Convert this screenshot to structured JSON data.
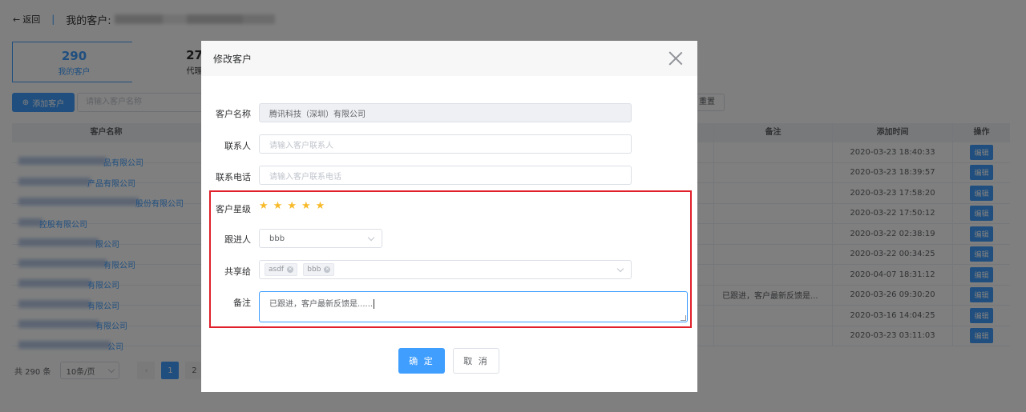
{
  "header": {
    "back_label": "返回",
    "title": "我的客户:"
  },
  "stats": [
    {
      "count": "290",
      "label": "我的客户"
    },
    {
      "count": "27",
      "label": "代理"
    }
  ],
  "toolbar": {
    "add_label": "添加客户",
    "search_placeholder": "请输入客户名称",
    "reset_label": "重置"
  },
  "table": {
    "headers": {
      "name": "客户名称",
      "note": "备注",
      "time": "添加时间",
      "op": "操作"
    },
    "rows": [
      {
        "name_tail": "品有限公司",
        "note": "",
        "time": "2020-03-23 18:40:33",
        "op": "编辑"
      },
      {
        "name_tail": "产品有限公司",
        "note": "",
        "time": "2020-03-23 18:39:57",
        "op": "编辑"
      },
      {
        "name_tail": "股份有限公司",
        "note": "",
        "time": "2020-03-23 17:58:20",
        "op": "编辑"
      },
      {
        "name_tail": "控股有限公司",
        "note": "",
        "time": "2020-03-22 17:50:12",
        "op": "编辑"
      },
      {
        "name_tail": "限公司",
        "note": "",
        "time": "2020-03-22 02:38:19",
        "op": "编辑"
      },
      {
        "name_tail": "有限公司",
        "note": "",
        "time": "2020-03-22 00:34:25",
        "op": "编辑"
      },
      {
        "name_tail": "有限公司",
        "note": "",
        "time": "2020-04-07 18:31:12",
        "op": "编辑"
      },
      {
        "name_tail": "有限公司",
        "note": "已跟进，客户最新反馈是...",
        "time": "2020-03-26 09:30:20",
        "op": "编辑"
      },
      {
        "name_tail": "有限公司",
        "note": "",
        "time": "2020-03-16 14:04:25",
        "op": "编辑"
      },
      {
        "name_tail": "公司",
        "note": "",
        "time": "2020-03-23 03:11:03",
        "op": "编辑"
      }
    ]
  },
  "pagination": {
    "total": "共 290 条",
    "page_size": "10条/页",
    "pages": [
      "1",
      "2"
    ]
  },
  "dialog": {
    "title": "修改客户",
    "fields": {
      "customer_name": {
        "label": "客户名称",
        "value": "腾讯科技（深圳）有限公司"
      },
      "contact": {
        "label": "联系人",
        "placeholder": "请输入客户联系人"
      },
      "phone": {
        "label": "联系电话",
        "placeholder": "请输入客户联系电话"
      },
      "rating": {
        "label": "客户星级",
        "stars": 5,
        "max": 5
      },
      "follower": {
        "label": "跟进人",
        "value": "bbb"
      },
      "share": {
        "label": "共享给",
        "tags": [
          "asdf",
          "bbb"
        ]
      },
      "remark": {
        "label": "备注",
        "value": "已跟进，客户最新反馈是......"
      }
    },
    "confirm_label": "确 定",
    "cancel_label": "取 消"
  },
  "colors": {
    "primary": "#409eff",
    "star": "#f7ba2a",
    "highlight": "#e0202a"
  },
  "icons": [
    "arrow-left-icon",
    "plus-circle-icon",
    "close-icon",
    "star-icon",
    "chevron-down-icon",
    "tag-remove-icon"
  ]
}
